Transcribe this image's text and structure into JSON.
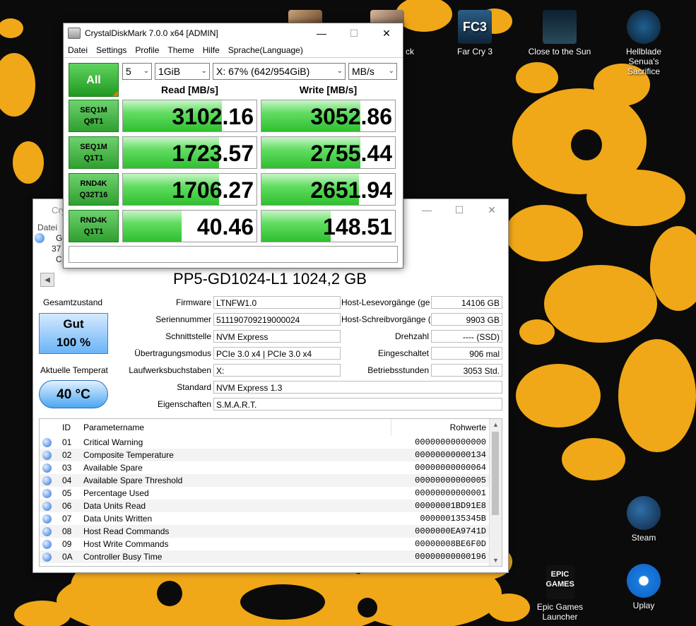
{
  "desktop": {
    "icons": [
      {
        "name": "Far Cry 3",
        "badge": "FC3"
      },
      {
        "name": "Close to the Sun"
      },
      {
        "name": "Hellblade Senua's Sacrifice"
      },
      {
        "name": "Steam"
      },
      {
        "name": "Epic Games Launcher",
        "badge": "EPIC GAMES"
      },
      {
        "name": "Uplay"
      }
    ],
    "partial_label": "ck",
    "colors": {
      "splash": "#f0a818",
      "background": "#0b0b0b"
    }
  },
  "cdm": {
    "title": "CrystalDiskMark 7.0.0 x64 [ADMIN]",
    "menu": [
      "Datei",
      "Settings",
      "Profile",
      "Theme",
      "Hilfe",
      "Sprache(Language)"
    ],
    "all_label": "All",
    "count": "5",
    "size": "1GiB",
    "drive": "X: 67% (642/954GiB)",
    "unit": "MB/s",
    "read_header": "Read [MB/s]",
    "write_header": "Write [MB/s]",
    "rows": [
      {
        "l1": "SEQ1M",
        "l2": "Q8T1",
        "read": "3102.16",
        "write": "3052.86",
        "read_fill": 0.74,
        "write_fill": 0.74
      },
      {
        "l1": "SEQ1M",
        "l2": "Q1T1",
        "read": "1723.57",
        "write": "2755.44",
        "read_fill": 0.72,
        "write_fill": 0.74
      },
      {
        "l1": "RND4K",
        "l2": "Q32T16",
        "read": "1706.27",
        "write": "2651.94",
        "read_fill": 0.72,
        "write_fill": 0.73
      },
      {
        "l1": "RND4K",
        "l2": "Q1T1",
        "read": "40.46",
        "write": "148.51",
        "read_fill": 0.44,
        "write_fill": 0.52
      }
    ],
    "comment": ""
  },
  "cdi": {
    "title": "Cry",
    "menu_first": "Datei",
    "drive_partial": [
      "Gu",
      "37",
      "C"
    ],
    "model": "PP5-GD1024-L1 1024,2 GB",
    "health_label": "Gesamtzustand",
    "health_status": "Gut",
    "health_percent": "100 %",
    "temp_label": "Aktuelle Temperat",
    "temp_value": "40 °C",
    "left_fields": [
      {
        "label": "Firmware",
        "value": "LTNFW1.0"
      },
      {
        "label": "Seriennummer",
        "value": "511190709219000024"
      },
      {
        "label": "Schnittstelle",
        "value": "NVM Express"
      },
      {
        "label": "Übertragungsmodus",
        "value": "PCIe 3.0 x4 | PCIe 3.0 x4"
      },
      {
        "label": "Laufwerksbuchstaben",
        "value": "X:"
      }
    ],
    "right_fields": [
      {
        "label": "Host-Lesevorgänge (ge",
        "value": "14106 GB"
      },
      {
        "label": "Host-Schreibvorgänge (",
        "value": "9903 GB"
      },
      {
        "label": "Drehzahl",
        "value": "---- (SSD)"
      },
      {
        "label": "Eingeschaltet",
        "value": "906 mal"
      },
      {
        "label": "Betriebsstunden",
        "value": "3053 Std."
      }
    ],
    "standard_label": "Standard",
    "standard_value": "NVM Express 1.3",
    "features_label": "Eigenschaften",
    "features_value": "S.M.A.R.T.",
    "smart_headers": {
      "id": "ID",
      "name": "Parametername",
      "raw": "Rohwerte"
    },
    "smart_rows": [
      {
        "id": "01",
        "name": "Critical Warning",
        "raw": "00000000000000"
      },
      {
        "id": "02",
        "name": "Composite Temperature",
        "raw": "00000000000134"
      },
      {
        "id": "03",
        "name": "Available Spare",
        "raw": "00000000000064"
      },
      {
        "id": "04",
        "name": "Available Spare Threshold",
        "raw": "00000000000005"
      },
      {
        "id": "05",
        "name": "Percentage Used",
        "raw": "00000000000001"
      },
      {
        "id": "06",
        "name": "Data Units Read",
        "raw": "00000001BD91E8"
      },
      {
        "id": "07",
        "name": "Data Units Written",
        "raw": "000000135345B"
      },
      {
        "id": "08",
        "name": "Host Read Commands",
        "raw": "0000000EA9741D"
      },
      {
        "id": "09",
        "name": "Host Write Commands",
        "raw": "00000008BE6F0D"
      },
      {
        "id": "0A",
        "name": "Controller Busy Time",
        "raw": "00000000000196"
      }
    ]
  }
}
